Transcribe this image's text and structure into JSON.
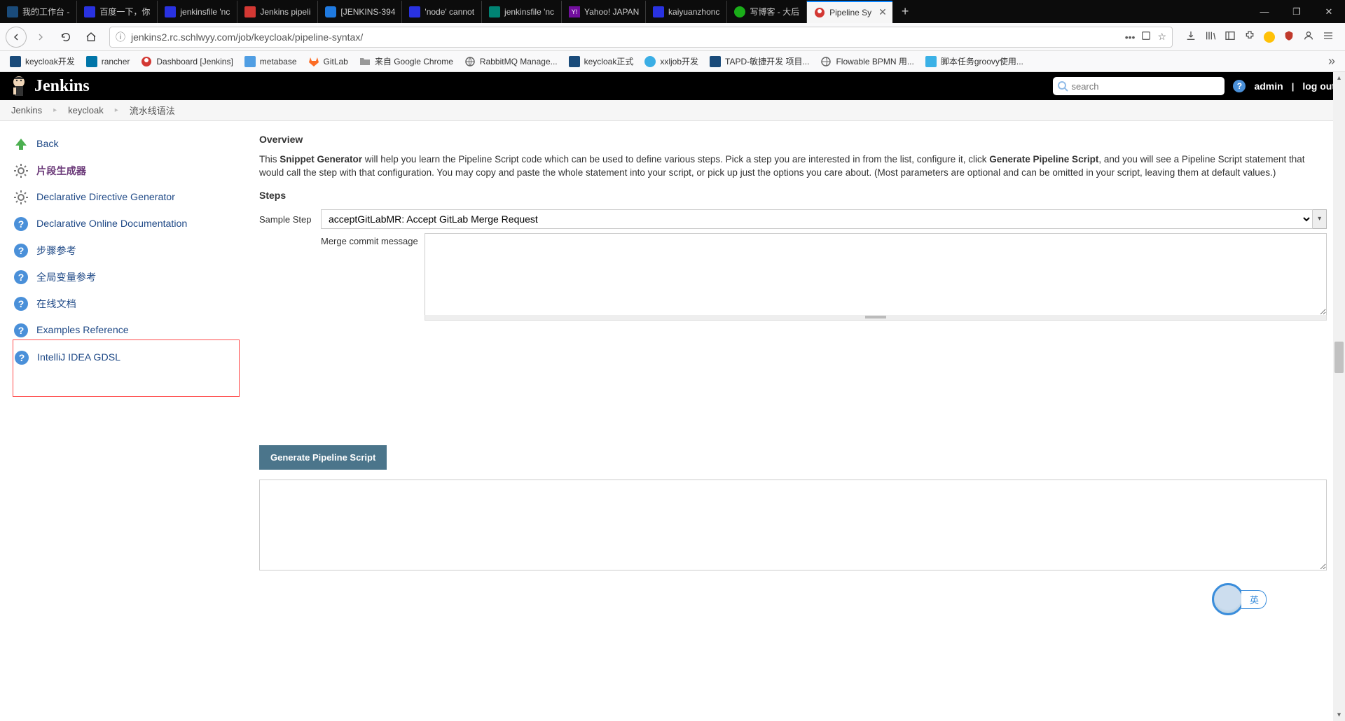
{
  "browser": {
    "tabs": [
      {
        "label": "我的工作台 - "
      },
      {
        "label": "百度一下，你"
      },
      {
        "label": "jenkinsfile 'nc"
      },
      {
        "label": "Jenkins pipeli"
      },
      {
        "label": "[JENKINS-394"
      },
      {
        "label": "'node' cannot"
      },
      {
        "label": "jenkinsfile 'nc"
      },
      {
        "label": "Yahoo! JAPAN"
      },
      {
        "label": "kaiyuanzhonc"
      },
      {
        "label": "写博客 - 大后"
      },
      {
        "label": "Pipeline Sy",
        "active": true
      }
    ],
    "url": "jenkins2.rc.schlwyy.com/job/keycloak/pipeline-syntax/",
    "bookmarks": [
      {
        "label": "keycloak开发"
      },
      {
        "label": "rancher"
      },
      {
        "label": "Dashboard [Jenkins]"
      },
      {
        "label": "metabase"
      },
      {
        "label": "GitLab"
      },
      {
        "label": "来自 Google Chrome"
      },
      {
        "label": "RabbitMQ Manage..."
      },
      {
        "label": "keycloak正式"
      },
      {
        "label": "xxljob开发"
      },
      {
        "label": "TAPD-敏捷开发 项目..."
      },
      {
        "label": "Flowable BPMN 用..."
      },
      {
        "label": "脚本任务groovy使用..."
      }
    ]
  },
  "header": {
    "brand": "Jenkins",
    "search_placeholder": "search",
    "user": "admin",
    "logout": "log out"
  },
  "breadcrumbs": {
    "items": [
      "Jenkins",
      "keycloak",
      "流水线语法"
    ]
  },
  "sidebar": {
    "items": [
      {
        "label": "Back"
      },
      {
        "label": "片段生成器"
      },
      {
        "label": "Declarative Directive Generator"
      },
      {
        "label": "Declarative Online Documentation"
      },
      {
        "label": "步骤参考"
      },
      {
        "label": "全局变量参考"
      },
      {
        "label": "在线文档"
      },
      {
        "label": "Examples Reference"
      },
      {
        "label": "IntelliJ IDEA GDSL"
      }
    ]
  },
  "main": {
    "overview_title": "Overview",
    "overview_part1": "This ",
    "overview_bold1": "Snippet Generator",
    "overview_part2": " will help you learn the Pipeline Script code which can be used to define various steps. Pick a step you are interested in from the list, configure it, click ",
    "overview_bold2": "Generate Pipeline Script",
    "overview_part3": ", and you will see a Pipeline Script statement that would call the step with that configuration. You may copy and paste the whole statement into your script, or pick up just the options you care about. (Most parameters are optional and can be omitted in your script, leaving them at default values.)",
    "steps_title": "Steps",
    "sample_step_label": "Sample Step",
    "sample_step_value": "acceptGitLabMR: Accept GitLab Merge Request",
    "merge_msg_label": "Merge commit message",
    "merge_msg_value": "",
    "generate_button": "Generate Pipeline Script",
    "output_value": ""
  },
  "ime": {
    "lang": "英"
  }
}
